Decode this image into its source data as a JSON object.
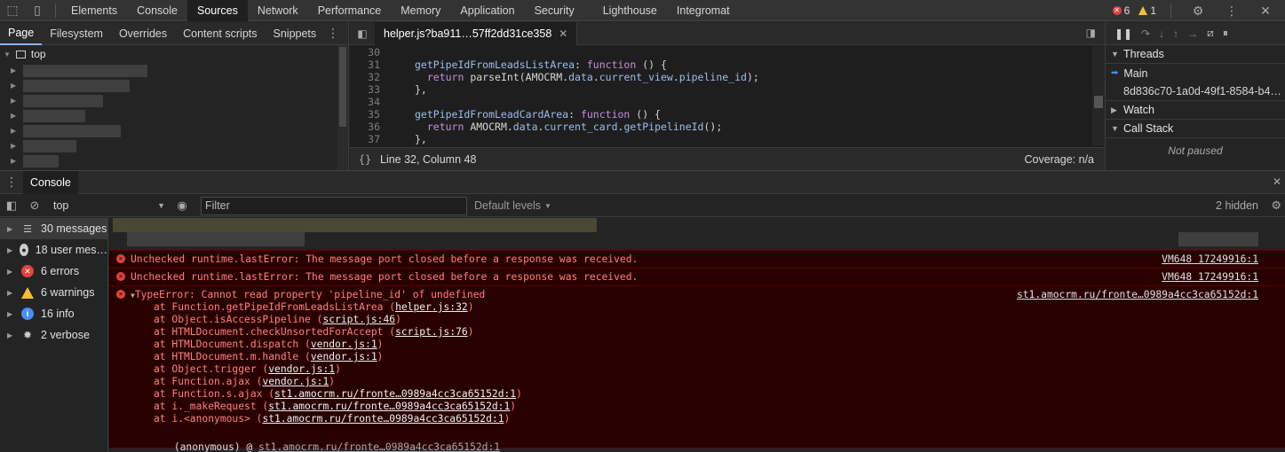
{
  "topbar": {
    "tabs": [
      "Elements",
      "Console",
      "Sources",
      "Network",
      "Performance",
      "Memory",
      "Application",
      "Security",
      "Lighthouse",
      "Integromat"
    ],
    "active_tab": "Sources",
    "error_count": "6",
    "warning_count": "1"
  },
  "navigator": {
    "tabs": [
      "Page",
      "Filesystem",
      "Overrides",
      "Content scripts",
      "Snippets"
    ],
    "tree_root": "top"
  },
  "editor": {
    "tab_title": "helper.js?ba911…57ff2dd31ce358",
    "lines": [
      {
        "n": "30",
        "parts": []
      },
      {
        "n": "31",
        "parts": [
          {
            "t": "prop",
            "v": "getPipeIdFromLeadsListArea"
          },
          {
            "t": "plain",
            "v": ": "
          },
          {
            "t": "kw",
            "v": "function"
          },
          {
            "t": "plain",
            "v": " () {"
          }
        ]
      },
      {
        "n": "32",
        "parts": [
          {
            "t": "plain",
            "v": "  "
          },
          {
            "t": "kw",
            "v": "return"
          },
          {
            "t": "plain",
            "v": " parseInt(AMOCRM."
          },
          {
            "t": "prop",
            "v": "data"
          },
          {
            "t": "plain",
            "v": "."
          },
          {
            "t": "prop",
            "v": "current_view"
          },
          {
            "t": "plain",
            "v": "."
          },
          {
            "t": "prop",
            "v": "pipeline_id"
          },
          {
            "t": "plain",
            "v": ");"
          }
        ]
      },
      {
        "n": "33",
        "parts": [
          {
            "t": "plain",
            "v": "},"
          }
        ]
      },
      {
        "n": "34",
        "parts": []
      },
      {
        "n": "35",
        "parts": [
          {
            "t": "prop",
            "v": "getPipeIdFromLeadCardArea"
          },
          {
            "t": "plain",
            "v": ": "
          },
          {
            "t": "kw",
            "v": "function"
          },
          {
            "t": "plain",
            "v": " () {"
          }
        ]
      },
      {
        "n": "36",
        "parts": [
          {
            "t": "plain",
            "v": "  "
          },
          {
            "t": "kw",
            "v": "return"
          },
          {
            "t": "plain",
            "v": " AMOCRM."
          },
          {
            "t": "prop",
            "v": "data"
          },
          {
            "t": "plain",
            "v": "."
          },
          {
            "t": "prop",
            "v": "current_card"
          },
          {
            "t": "plain",
            "v": "."
          },
          {
            "t": "prop",
            "v": "getPipelineId"
          },
          {
            "t": "plain",
            "v": "();"
          }
        ]
      },
      {
        "n": "37",
        "parts": [
          {
            "t": "plain",
            "v": "},"
          }
        ]
      }
    ],
    "status_braces": "{}",
    "status_position": "Line 32, Column 48",
    "status_coverage": "Coverage: n/a"
  },
  "debugger": {
    "threads_label": "Threads",
    "main_thread": "Main",
    "thread_id": "8d836c70-1a0d-49f1-8584-b4…",
    "watch_label": "Watch",
    "callstack_label": "Call Stack",
    "not_paused": "Not paused"
  },
  "drawer": {
    "tab": "Console"
  },
  "console_toolbar": {
    "context": "top",
    "filter_placeholder": "Filter",
    "levels": "Default levels",
    "hidden": "2 hidden"
  },
  "console_sidebar": [
    {
      "label": "30 messages",
      "icon": "list-icon",
      "active": true
    },
    {
      "label": "18 user mes…",
      "icon": "user-icon",
      "active": false
    },
    {
      "label": "6 errors",
      "icon": "error-icon",
      "active": false
    },
    {
      "label": "6 warnings",
      "icon": "warning-icon",
      "active": false
    },
    {
      "label": "16 info",
      "icon": "info-icon",
      "active": false
    },
    {
      "label": "2 verbose",
      "icon": "bug-icon",
      "active": false
    }
  ],
  "console_messages": {
    "runtime_error_text": "Unchecked runtime.lastError: The message port closed before a response was received.",
    "runtime_error_source": "VM648 17249916:1",
    "type_error_text": "TypeError: Cannot read property 'pipeline_id' of undefined",
    "type_error_source": "st1.amocrm.ru/fronte…0989a4cc3ca65152d:1",
    "stack": [
      {
        "fn": "at Function.getPipeIdFromLeadsListArea",
        "loc": "helper.js:32"
      },
      {
        "fn": "at Object.isAccessPipeline",
        "loc": "script.js:46"
      },
      {
        "fn": "at HTMLDocument.checkUnsortedForAccept",
        "loc": "script.js:76"
      },
      {
        "fn": "at HTMLDocument.dispatch",
        "loc": "vendor.js:1"
      },
      {
        "fn": "at HTMLDocument.m.handle",
        "loc": "vendor.js:1"
      },
      {
        "fn": "at Object.trigger",
        "loc": "vendor.js:1"
      },
      {
        "fn": "at Function.ajax",
        "loc": "vendor.js:1"
      },
      {
        "fn": "at Function.s.ajax",
        "loc": "st1.amocrm.ru/fronte…0989a4cc3ca65152d:1"
      },
      {
        "fn": "at i._makeRequest",
        "loc": "st1.amocrm.ru/fronte…0989a4cc3ca65152d:1"
      },
      {
        "fn": "at i.<anonymous>",
        "loc": "st1.amocrm.ru/fronte…0989a4cc3ca65152d:1"
      }
    ],
    "anon_prefix": "(anonymous) @ ",
    "anon_link": "st1.amocrm.ru/fronte…0989a4cc3ca65152d:1"
  },
  "colors": {
    "error_red": "#e0443e",
    "warning_yellow": "#f2c037",
    "info_blue": "#4a8ef0",
    "error_bg": "#290000"
  }
}
